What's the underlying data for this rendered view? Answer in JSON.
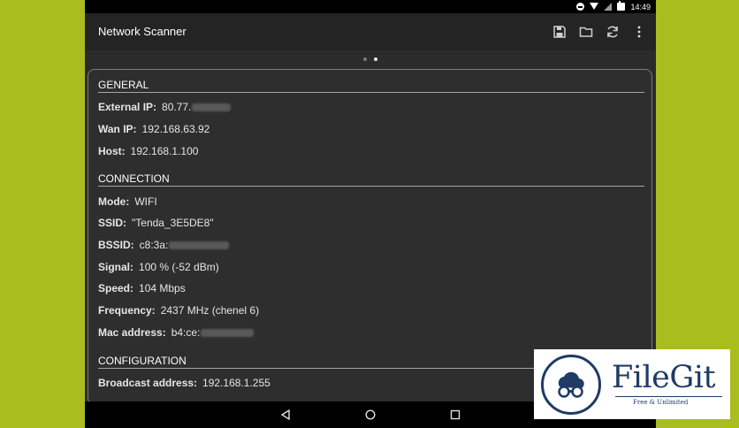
{
  "status_bar": {
    "time": "14:49"
  },
  "toolbar": {
    "title": "Network Scanner",
    "actions": [
      "save-icon",
      "folder-icon",
      "refresh-icon",
      "overflow-menu-icon"
    ]
  },
  "pager": {
    "pages": 2,
    "active": 2
  },
  "sections": {
    "general": {
      "title": "GENERAL",
      "external_ip": {
        "label": "External IP:",
        "value": "80.77."
      },
      "wan_ip": {
        "label": "Wan IP:",
        "value": "192.168.63.92"
      },
      "host": {
        "label": "Host:",
        "value": "192.168.1.100"
      }
    },
    "connection": {
      "title": "CONNECTION",
      "mode": {
        "label": "Mode:",
        "value": "WIFI"
      },
      "ssid": {
        "label": "SSID:",
        "value": "\"Tenda_3E5DE8\""
      },
      "bssid": {
        "label": "BSSID:",
        "value": "c8:3a:"
      },
      "signal": {
        "label": "Signal:",
        "value": "100 % (-52 dBm)"
      },
      "speed": {
        "label": "Speed:",
        "value": "104 Mbps"
      },
      "frequency": {
        "label": "Frequency:",
        "value": "2437 MHz (chenel 6)"
      },
      "mac": {
        "label": "Mac address:",
        "value": "b4:ce:"
      }
    },
    "configuration": {
      "title": "CONFIGURATION",
      "broadcast": {
        "label": "Broadcast address:",
        "value": "192.168.1.255"
      }
    }
  },
  "watermark": {
    "name": "FileGit",
    "tagline": "Free & Unlimited"
  },
  "colors": {
    "background": "#a9bd1e",
    "card": "#2e2e2e",
    "toolbar": "#242424",
    "brand": "#1f3b66"
  }
}
